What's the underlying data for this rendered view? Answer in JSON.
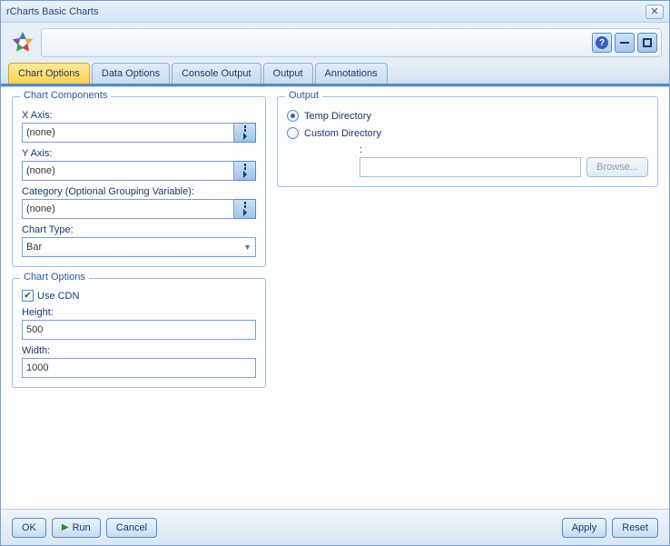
{
  "window": {
    "title": "rCharts Basic Charts"
  },
  "toolbar": {
    "help_icon": "?",
    "minimize_icon": "−",
    "maximize_icon": "□"
  },
  "tabs": [
    {
      "label": "Chart Options",
      "active": true
    },
    {
      "label": "Data Options",
      "active": false
    },
    {
      "label": "Console Output",
      "active": false
    },
    {
      "label": "Output",
      "active": false
    },
    {
      "label": "Annotations",
      "active": false
    }
  ],
  "chart_components": {
    "legend": "Chart Components",
    "xaxis_label": "X Axis:",
    "xaxis_value": "(none)",
    "yaxis_label": "Y Axis:",
    "yaxis_value": "(none)",
    "category_label": "Category (Optional Grouping Variable):",
    "category_value": "(none)",
    "charttype_label": "Chart Type:",
    "charttype_value": "Bar"
  },
  "chart_options": {
    "legend": "Chart Options",
    "use_cdn_label": "Use CDN",
    "use_cdn_checked": true,
    "height_label": "Height:",
    "height_value": "500",
    "width_label": "Width:",
    "width_value": "1000"
  },
  "output": {
    "legend": "Output",
    "temp_label": "Temp Directory",
    "custom_label": "Custom Directory",
    "selected": "temp",
    "path_label": ":",
    "path_value": "",
    "browse_label": "Browse..."
  },
  "footer": {
    "ok": "OK",
    "run": "Run",
    "cancel": "Cancel",
    "apply": "Apply",
    "reset": "Reset"
  }
}
